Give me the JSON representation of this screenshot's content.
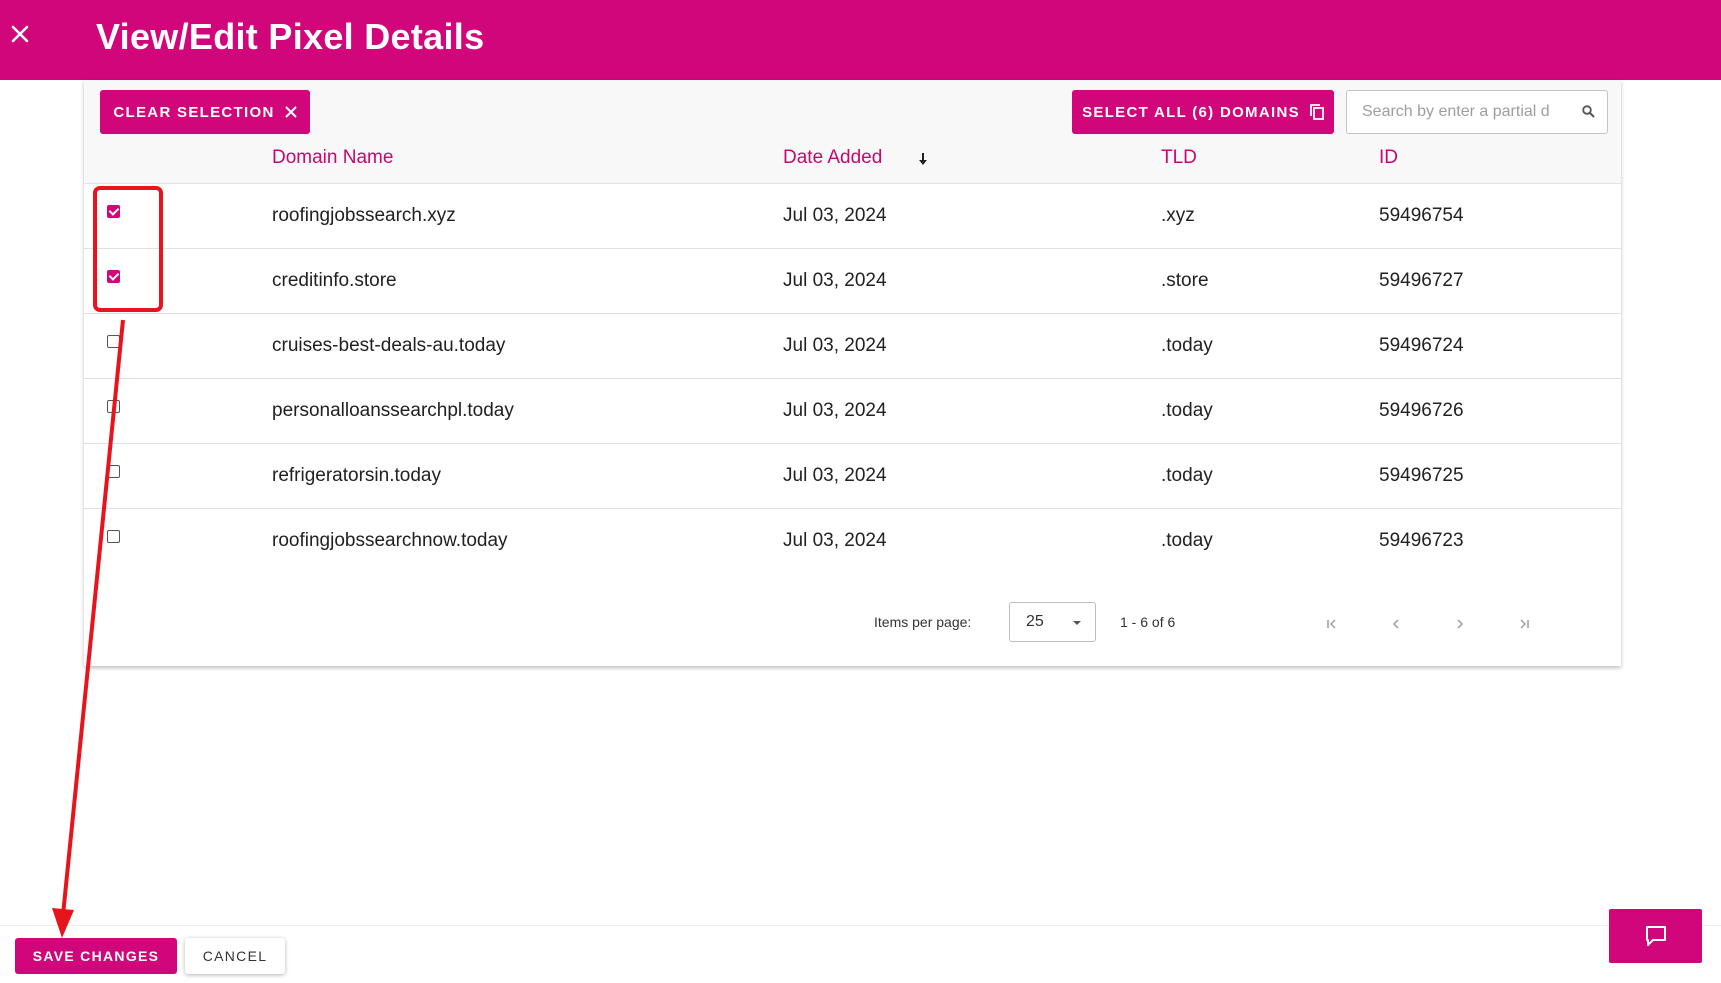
{
  "header": {
    "title": "View/Edit Pixel Details",
    "close_icon": "close-icon",
    "bg_color": "#d1067a"
  },
  "toolbar": {
    "clear_selection_label": "CLEAR SELECTION",
    "select_all_label": "SELECT ALL (6) DOMAINS",
    "search_placeholder": "Search by enter a partial d"
  },
  "table": {
    "columns": [
      "Domain Name",
      "Date Added",
      "TLD",
      "ID"
    ],
    "sort_column": "Date Added",
    "rows": [
      {
        "checked": true,
        "domain": "roofingjobssearch.xyz",
        "date": "Jul 03, 2024",
        "tld": ".xyz",
        "id": "59496754"
      },
      {
        "checked": true,
        "domain": "creditinfo.store",
        "date": "Jul 03, 2024",
        "tld": ".store",
        "id": "59496727"
      },
      {
        "checked": false,
        "domain": "cruises-best-deals-au.today",
        "date": "Jul 03, 2024",
        "tld": ".today",
        "id": "59496724"
      },
      {
        "checked": false,
        "domain": "personalloanssearchpl.today",
        "date": "Jul 03, 2024",
        "tld": ".today",
        "id": "59496726"
      },
      {
        "checked": false,
        "domain": "refrigeratorsin.today",
        "date": "Jul 03, 2024",
        "tld": ".today",
        "id": "59496725"
      },
      {
        "checked": false,
        "domain": "roofingjobssearchnow.today",
        "date": "Jul 03, 2024",
        "tld": ".today",
        "id": "59496723"
      }
    ]
  },
  "paginator": {
    "items_per_page_label": "Items per page:",
    "items_per_page_value": "25",
    "range_label": "1 - 6 of 6"
  },
  "footer": {
    "save_label": "SAVE CHANGES",
    "cancel_label": "CANCEL"
  },
  "colors": {
    "accent": "#d1067a",
    "annotation": "#e8141c"
  }
}
